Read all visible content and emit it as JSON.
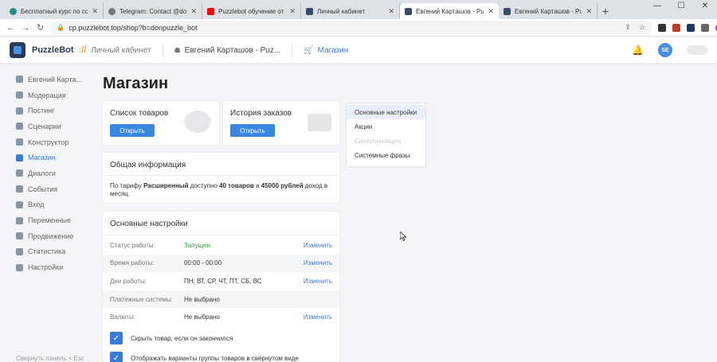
{
  "browser": {
    "tabs": [
      {
        "title": "Бесплатный курс по создани",
        "color": "#1f8f86"
      },
      {
        "title": "Telegram: Contact @donpuzzle",
        "color": "#777777"
      },
      {
        "title": "Puzzlebot обучение от А до Я",
        "color": "#ff0000"
      },
      {
        "title": "Личный кабинет",
        "color": "#3a4a6b"
      },
      {
        "title": "Евгений Карташов - Puzzlebot",
        "color": "#3a4a6b",
        "active": true
      },
      {
        "title": "Евгений Карташов - Puzzlebot",
        "color": "#3a4a6b"
      }
    ],
    "url": "cp.puzzlebot.top/shop?b=donpuzzle_bot",
    "new_tab": "+",
    "close": "✕"
  },
  "header": {
    "brand": "PuzzleBot",
    "brand_sep": "://",
    "crumb1": "Личный кабинет",
    "crumb2": "Евгений Карташов - Puz...",
    "crumb3": "Магазин",
    "avatar": "SE"
  },
  "sidebar": {
    "items": [
      {
        "label": "Евгений Карта..."
      },
      {
        "label": "Модерация"
      },
      {
        "label": "Постинг"
      },
      {
        "label": "Сценарии"
      },
      {
        "label": "Конструктор"
      },
      {
        "label": "Магазин",
        "active": true
      },
      {
        "label": "Диалоги"
      },
      {
        "label": "События"
      },
      {
        "label": "Вход"
      },
      {
        "label": "Переменные"
      },
      {
        "label": "Продвижение"
      },
      {
        "label": "Статистика"
      },
      {
        "label": "Настройки"
      }
    ],
    "bottom": "Свернуть панель < Esc"
  },
  "main": {
    "title": "Магазин",
    "products_card": {
      "title": "Список товаров",
      "button": "Открыть"
    },
    "orders_card": {
      "title": "История заказов",
      "button": "Открыть"
    },
    "info_card": {
      "title": "Общая информация",
      "text_prefix": "По тарифу ",
      "plan": "Расширенный",
      "text_mid": " доступно ",
      "products_count": "40 товаров",
      "text_and": " и ",
      "revenue": "45000 рублей",
      "text_suffix": " доход в месяц."
    },
    "settings_card": {
      "title": "Основные настройки",
      "rows": [
        {
          "label": "Статус работы:",
          "value": "Запущен",
          "link": "Изменить"
        },
        {
          "label": "Время работы:",
          "value": "00:00 - 00:00",
          "link": "Изменить"
        },
        {
          "label": "Дни работы:",
          "value": "ПН, ВТ, СР, ЧТ, ПТ, СБ, ВС",
          "link": "Изменить"
        },
        {
          "label": "Платежные системы:",
          "value": "Не выбрано",
          "link": ""
        },
        {
          "label": "Валюты:",
          "value": "Не выбрано",
          "link": "Изменить"
        }
      ],
      "checkboxes": [
        {
          "label": "Скрыть товар, если он закончился",
          "checked": true
        },
        {
          "label": "Отображать варианты группы товаров в свёрнутом виде",
          "checked": true
        }
      ]
    },
    "menu": {
      "items": [
        {
          "label": "Основные настройки",
          "selected": true
        },
        {
          "label": "Акции"
        },
        {
          "label": "Синхронизация",
          "disabled": true
        },
        {
          "label": "Системные фразы"
        }
      ]
    }
  }
}
